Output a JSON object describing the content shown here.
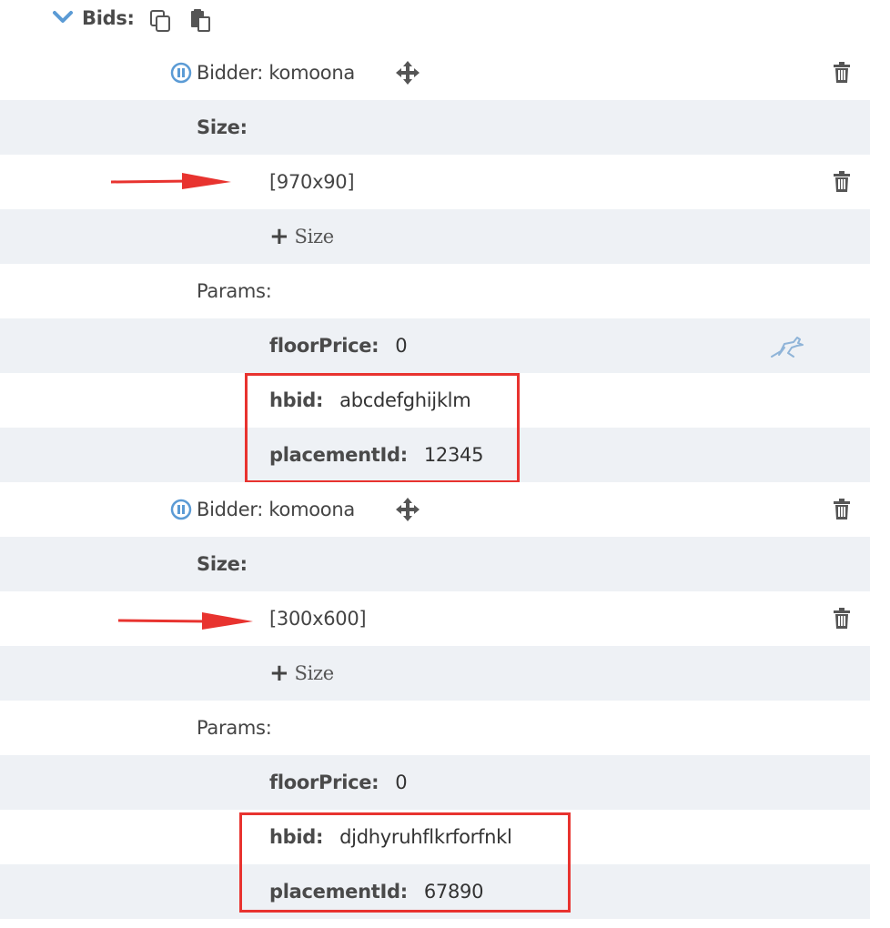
{
  "header": {
    "title": "Bids:",
    "icons": [
      "chevron-down-icon",
      "copy-icon",
      "paste-icon"
    ]
  },
  "bidders": [
    {
      "label": "Bidder: komoona",
      "size_label": "Size:",
      "size_value": "[970x90]",
      "add_size_label": "Size",
      "params_label": "Params:",
      "params": [
        {
          "key": "floorPrice:",
          "value": "0"
        },
        {
          "key": "hbid:",
          "value": "abcdefghijklm"
        },
        {
          "key": "placementId:",
          "value": "12345"
        }
      ]
    },
    {
      "label": "Bidder: komoona",
      "size_label": "Size:",
      "size_value": "[300x600]",
      "add_size_label": "Size",
      "params_label": "Params:",
      "params": [
        {
          "key": "floorPrice:",
          "value": "0"
        },
        {
          "key": "hbid:",
          "value": "djdhyruhflkrforfnkl"
        },
        {
          "key": "placementId:",
          "value": "67890"
        }
      ]
    }
  ],
  "colors": {
    "accent_blue": "#5b9bd5",
    "row_alt": "#eef1f5",
    "annotation_red": "#e8332f"
  }
}
